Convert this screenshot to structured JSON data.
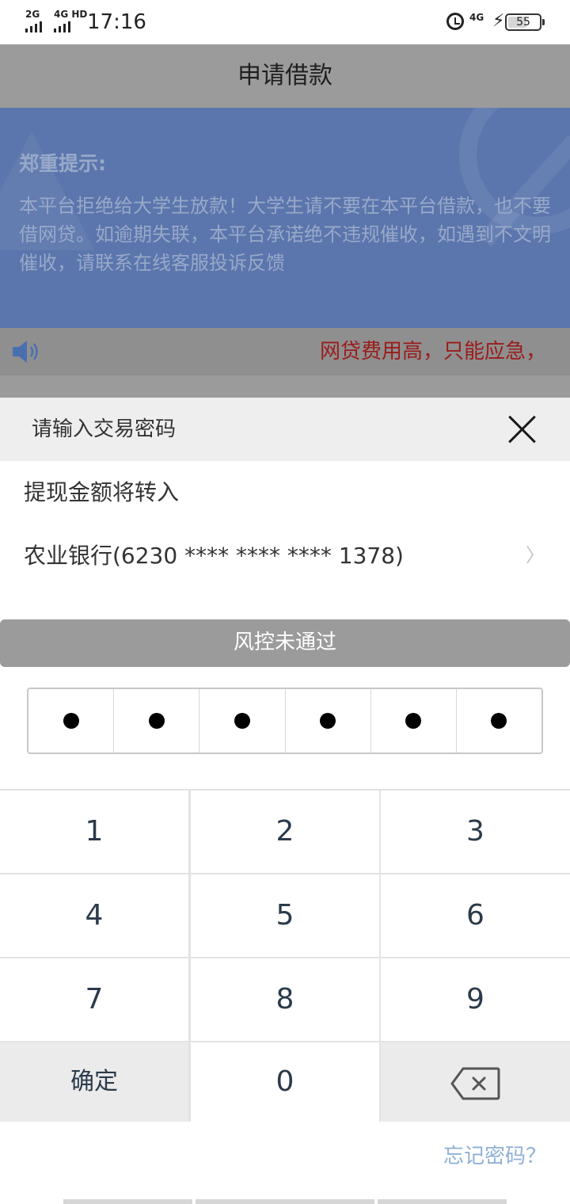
{
  "status_bar": {
    "signal_1_label": "2G",
    "signal_2_label": "4G HD",
    "time": "17:16",
    "network_label": "4G",
    "battery_level": "55"
  },
  "page": {
    "title": "申请借款",
    "notice_title": "郑重提示:",
    "notice_body": "本平台拒绝给大学生放款！大学生请不要在本平台借款，也不要借网贷。如逾期失联，本平台承诺绝不违规催收，如遇到不文明催收，请联系在线客服投诉反馈",
    "ticker_text": "网贷费用高，只能应急，"
  },
  "sheet": {
    "title": "请输入交易密码",
    "transfer_label": "提现金额将转入",
    "bank_account": "农业银行(6230 **** **** **** 1378)",
    "risk_status": "风控未通过",
    "password_length": 6,
    "forgot_password": "忘记密码？"
  },
  "keypad": {
    "keys": [
      "1",
      "2",
      "3",
      "4",
      "5",
      "6",
      "7",
      "8",
      "9"
    ],
    "confirm_label": "确定",
    "zero": "0",
    "delete_icon": "backspace-icon"
  },
  "colors": {
    "overlay_gray": "#9b9b9b",
    "notice_blue": "#5b76ad",
    "ticker_red": "#9b1b1b",
    "link_blue": "#8fb0d6"
  }
}
